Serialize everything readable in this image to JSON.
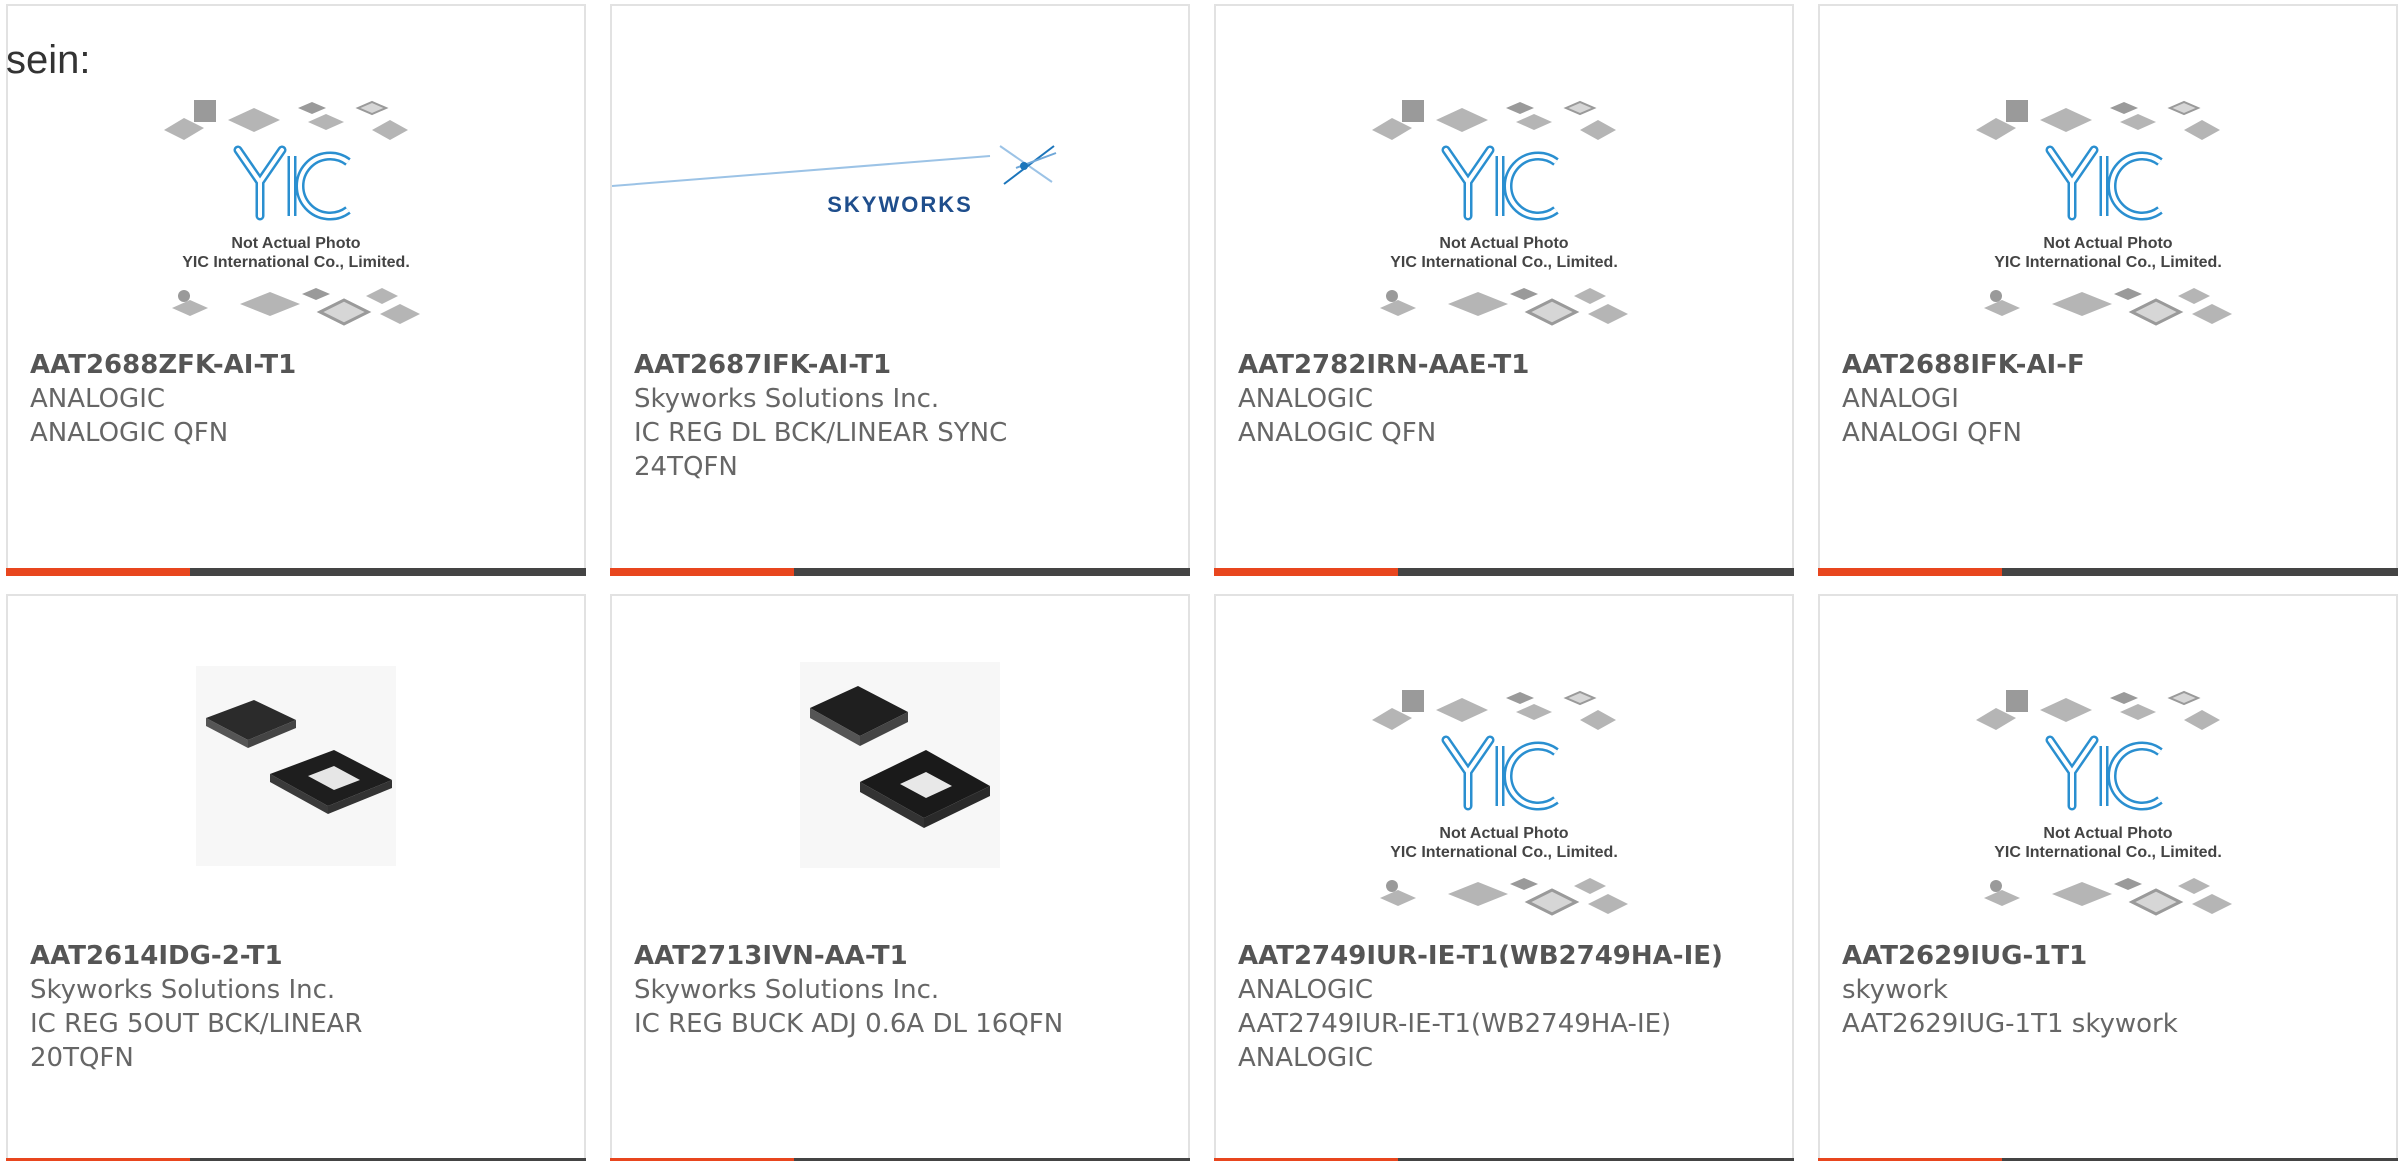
{
  "lead_text": "sein:",
  "placeholder": {
    "line1": "Not Actual Photo",
    "line2": "YIC International Co., Limited."
  },
  "skyworks_logo_text": "SKYWORKS",
  "colors": {
    "accent": "#e8461e",
    "bar": "#444444",
    "border": "#e2e2e2",
    "logo_blue": "#1b75bb"
  },
  "products": [
    {
      "part": "AAT2688ZFK-AI-T1",
      "manufacturer": "ANALOGIC",
      "description": "ANALOGIC QFN",
      "image": "not-actual-photo"
    },
    {
      "part": "AAT2687IFK-AI-T1",
      "manufacturer": "Skyworks Solutions Inc.",
      "description": "IC REG DL BCK/LINEAR SYNC 24TQFN",
      "image": "skyworks-logo"
    },
    {
      "part": "AAT2782IRN-AAE-T1",
      "manufacturer": "ANALOGIC",
      "description": "ANALOGIC QFN",
      "image": "not-actual-photo"
    },
    {
      "part": "AAT2688IFK-AI-F",
      "manufacturer": "ANALOGI",
      "description": "ANALOGI QFN",
      "image": "not-actual-photo"
    },
    {
      "part": "AAT2614IDG-2-T1",
      "manufacturer": "Skyworks Solutions Inc.",
      "description": "IC REG 5OUT BCK/LINEAR 20TQFN",
      "image": "chip-photo"
    },
    {
      "part": "AAT2713IVN-AA-T1",
      "manufacturer": "Skyworks Solutions Inc.",
      "description": "IC REG BUCK ADJ 0.6A DL 16QFN",
      "image": "chip-photo"
    },
    {
      "part": "AAT2749IUR-IE-T1(WB2749HA-IE)",
      "manufacturer": "ANALOGIC",
      "description": "AAT2749IUR-IE-T1(WB2749HA-IE) ANALOGIC",
      "image": "not-actual-photo"
    },
    {
      "part": "AAT2629IUG-1T1",
      "manufacturer": "skywork",
      "description": "AAT2629IUG-1T1 skywork",
      "image": "not-actual-photo"
    }
  ]
}
